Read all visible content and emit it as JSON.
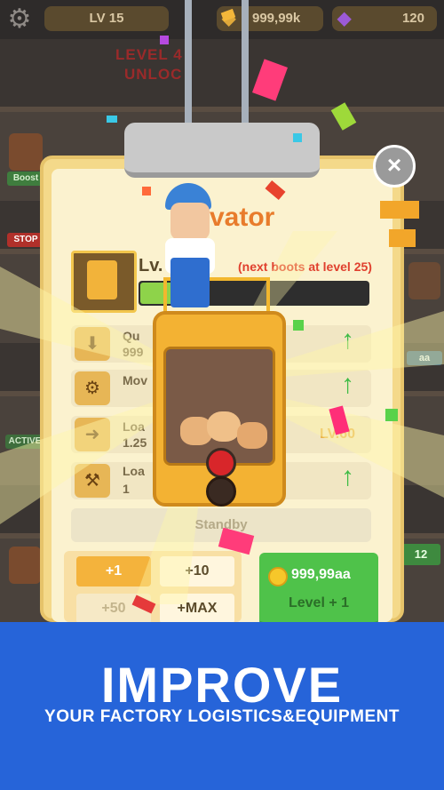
{
  "top_bar": {
    "level": "LV 15",
    "money": "999,99k",
    "gems": "120"
  },
  "background_text": {
    "level_unlock_line1": "LEVEL 4",
    "level_unlock_line2": "UNLOC",
    "boost_label": "Boost",
    "stop_label": "STOP",
    "active_label": "ACTIVE",
    "side_value": "aa",
    "side_number": "12"
  },
  "panel": {
    "title": "vator",
    "level_label": "Lv.",
    "next_boots": "(next boots at level 25)",
    "rows": [
      {
        "label": "Qu",
        "value": "999",
        "icon": "crate-icon"
      },
      {
        "label": "Mov",
        "value": "",
        "icon": "gear-icon"
      },
      {
        "label": "Loa",
        "value": "1.25",
        "icon": "load-icon",
        "right_text": "LV.60"
      },
      {
        "label": "Loa",
        "value": "1",
        "icon": "claw-icon"
      }
    ],
    "standby": "Standby",
    "buttons": {
      "plus1": "+1",
      "plus10": "+10",
      "plus50": "+50",
      "plusmax": "+MAX"
    },
    "upgrade": {
      "cost": "999,99aa",
      "label": "Level + 1"
    }
  },
  "banner": {
    "title": "IMPROVE",
    "subtitle": "YOUR FACTORY LOGISTICS&EQUIPMENT"
  }
}
